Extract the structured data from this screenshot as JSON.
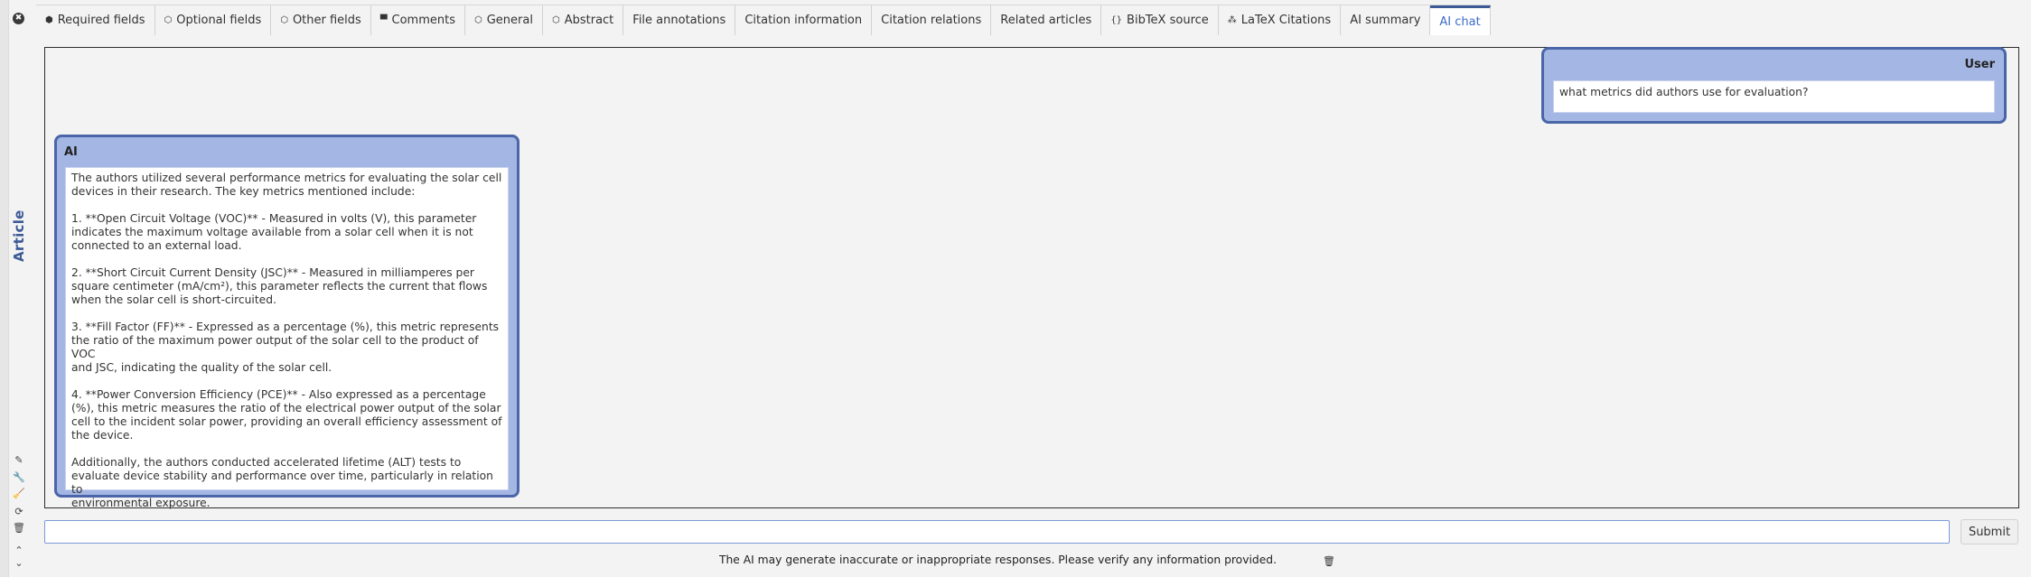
{
  "window": {
    "close_glyph": "✖"
  },
  "side": {
    "label": "Article",
    "tools": [
      {
        "icon": "pencil-icon",
        "glyph": "✎"
      },
      {
        "icon": "wrench-icon",
        "glyph": "🔧"
      },
      {
        "icon": "broom-icon",
        "glyph": "🧹"
      },
      {
        "icon": "refresh-icon",
        "glyph": "⟳"
      },
      {
        "icon": "trash-icon",
        "glyph": "🗑"
      },
      {
        "icon": "chevron-up-icon",
        "glyph": "⌃"
      },
      {
        "icon": "chevron-down-icon",
        "glyph": "⌄"
      }
    ]
  },
  "tabs": [
    {
      "label": "Required fields",
      "icon": "tag-filled-icon",
      "glyph": "⬢"
    },
    {
      "label": "Optional fields",
      "icon": "tag-outline-icon",
      "glyph": "⬡"
    },
    {
      "label": "Other fields",
      "icon": "tag-outline-icon",
      "glyph": "⬡"
    },
    {
      "label": "Comments",
      "icon": "comment-icon",
      "glyph": "▀"
    },
    {
      "label": "General",
      "icon": "tag-outline-icon",
      "glyph": "⬡"
    },
    {
      "label": "Abstract",
      "icon": "tag-outline-icon",
      "glyph": "⬡"
    },
    {
      "label": "File annotations",
      "icon": "",
      "glyph": ""
    },
    {
      "label": "Citation information",
      "icon": "",
      "glyph": ""
    },
    {
      "label": "Citation relations",
      "icon": "",
      "glyph": ""
    },
    {
      "label": "Related articles",
      "icon": "",
      "glyph": ""
    },
    {
      "label": "BibTeX source",
      "icon": "braces-icon",
      "glyph": "{}"
    },
    {
      "label": "LaTeX Citations",
      "icon": "latex-icon",
      "glyph": "⁂"
    },
    {
      "label": "AI summary",
      "icon": "",
      "glyph": ""
    },
    {
      "label": "AI chat",
      "icon": "",
      "glyph": "",
      "active": true
    }
  ],
  "chat": {
    "user": {
      "name": "User",
      "message": "what metrics did authors use for evaluation?"
    },
    "ai": {
      "name": "AI",
      "paragraphs": [
        "The authors utilized several performance metrics for evaluating the solar cell\ndevices in their research. The key metrics mentioned include:",
        "1. **Open Circuit Voltage (VOC)** - Measured in volts (V), this parameter\nindicates the maximum voltage available from a solar cell when it is not\nconnected to an external load.",
        "2. **Short Circuit Current Density (JSC)** - Measured in milliamperes per\nsquare centimeter (mA/cm²), this parameter reflects the current that flows\nwhen the solar cell is short-circuited.",
        "3. **Fill Factor (FF)** - Expressed as a percentage (%), this metric represents\nthe ratio of the maximum power output of the solar cell to the product of VOC\nand JSC, indicating the quality of the solar cell.",
        "4. **Power Conversion Efficiency (PCE)** - Also expressed as a percentage\n(%), this metric measures the ratio of the electrical power output of the solar\ncell to the incident solar power, providing an overall efficiency assessment of\nthe device.",
        "Additionally, the authors conducted accelerated lifetime (ALT) tests to\nevaluate device stability and performance over time, particularly in relation to\nenvironmental exposure."
      ]
    }
  },
  "input": {
    "value": "",
    "placeholder": ""
  },
  "submit_label": "Submit",
  "disclaimer": "The AI may generate inaccurate or inappropriate responses. Please verify any information provided.",
  "colors": {
    "accent": "#3c5a96",
    "bubble_fill": "#a4b6e4",
    "bubble_border": "#4a66a8",
    "active_tab_text": "#3c6cc8"
  }
}
